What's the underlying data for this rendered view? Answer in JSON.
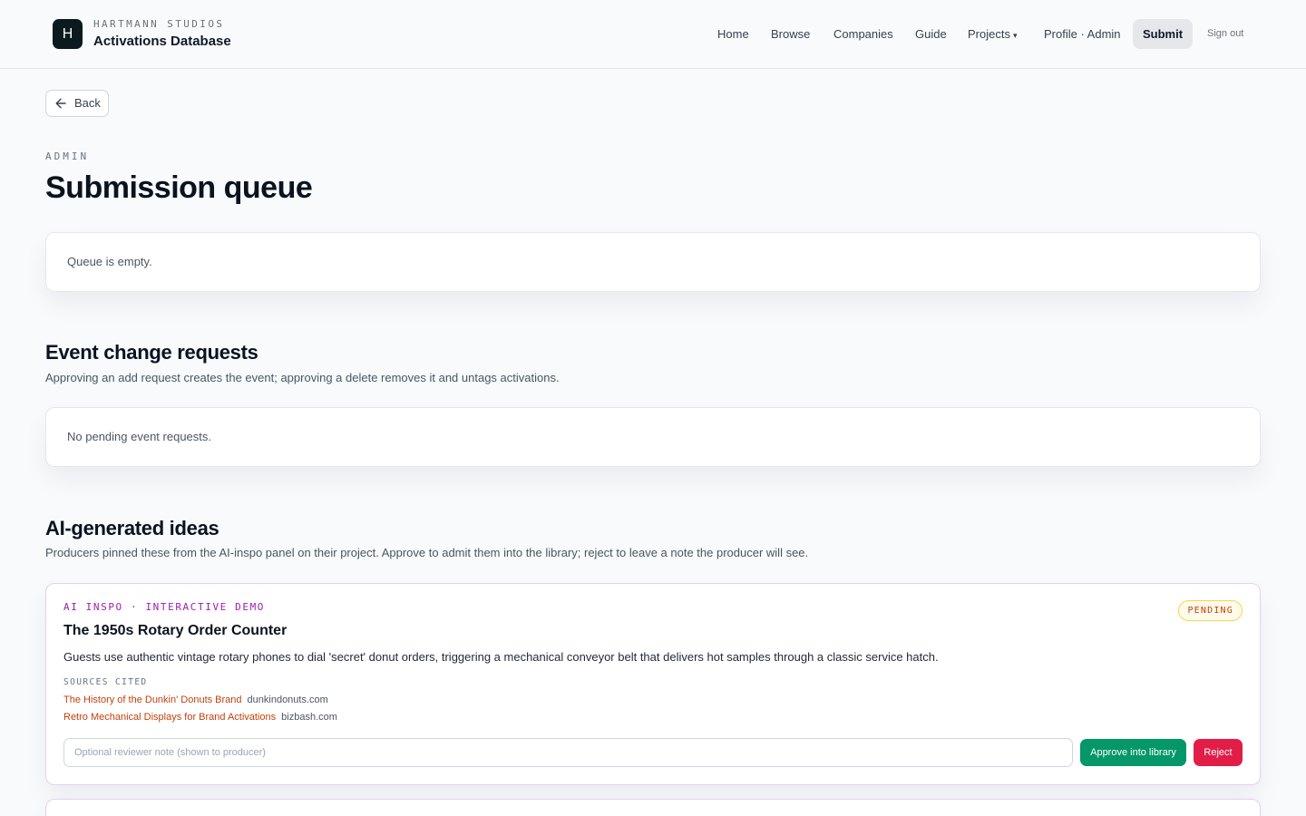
{
  "brand": {
    "logo_letter": "H",
    "kicker": "HARTMANN STUDIOS",
    "title": "Activations Database"
  },
  "nav": {
    "items": [
      "Home",
      "Browse",
      "Companies",
      "Guide",
      "Projects",
      "Profile · Admin",
      "Submit",
      "Sign out"
    ],
    "projects_caret": "▾",
    "active": "Submit"
  },
  "back": {
    "label": "Back"
  },
  "page": {
    "kicker": "ADMIN",
    "title": "Submission queue"
  },
  "queue": {
    "empty_message": "Queue is empty."
  },
  "event_requests": {
    "title": "Event change requests",
    "subtitle": "Approving an add request creates the event; approving a delete removes it and untags activations.",
    "empty_message": "No pending event requests."
  },
  "ai_ideas": {
    "title": "AI-generated ideas",
    "subtitle": "Producers pinned these from the AI-inspo panel on their project. Approve to admit them into the library; reject to leave a note the producer will see.",
    "items": [
      {
        "tag": "AI INSPO · INTERACTIVE DEMO",
        "status": "PENDING",
        "title": "The 1950s Rotary Order Counter",
        "description": "Guests use authentic vintage rotary phones to dial 'secret' donut orders, triggering a mechanical conveyor belt that delivers hot samples through a classic service hatch.",
        "sources_label": "SOURCES CITED",
        "sources": [
          {
            "title": "The History of the Dunkin' Donuts Brand",
            "domain": "dunkindonuts.com"
          },
          {
            "title": "Retro Mechanical Displays for Brand Activations",
            "domain": "bizbash.com"
          }
        ],
        "note_placeholder": "Optional reviewer note (shown to producer)",
        "note_value": "",
        "approve_label": "Approve into library",
        "reject_label": "Reject"
      }
    ]
  },
  "colors": {
    "accent_purple": "#a21caf",
    "pending_orange": "#c2410c",
    "approve_green": "#059669",
    "reject_red": "#e11d48",
    "logo_dark": "#0b1a1e"
  }
}
